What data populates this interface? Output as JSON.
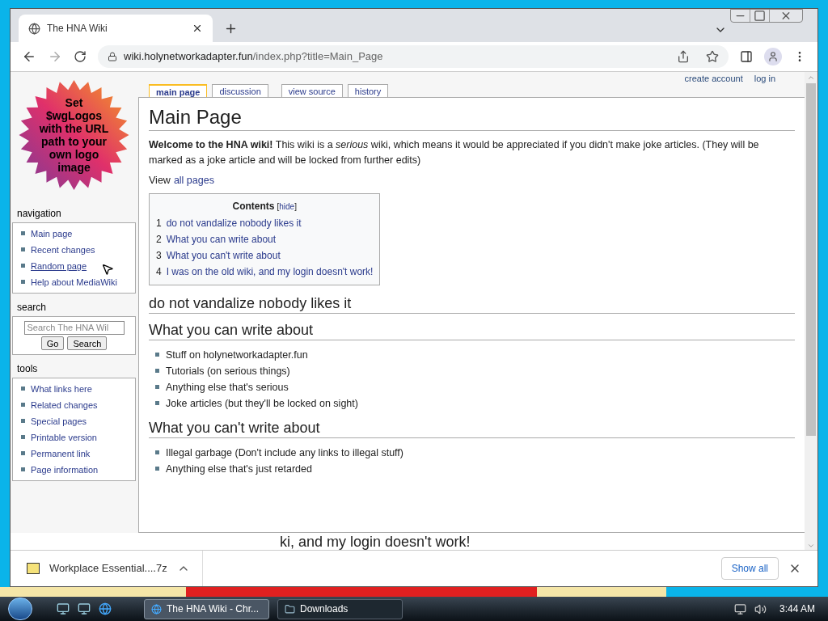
{
  "browser": {
    "tabs": [
      {
        "title": "The HNA Wiki",
        "selected": true
      }
    ],
    "url_host": "wiki.holynetworkadapter.fun",
    "url_path": "/index.php?title=Main_Page"
  },
  "wiki": {
    "personal_links": [
      "create account",
      "log in"
    ],
    "page_tabs": [
      {
        "label": "main page",
        "selected": true
      },
      {
        "label": "discussion",
        "selected": false
      },
      {
        "label": "view source",
        "selected": false
      },
      {
        "label": "history",
        "selected": false
      }
    ],
    "title": "Main Page",
    "intro": "**Welcome to the HNA wiki!** This wiki is a *serious* wiki, which means it would be appreciated if you didn't make joke articles. (They will be marked as a joke article and will be locked from further edits)",
    "view_all": {
      "prefix": "View",
      "link": "all pages"
    },
    "toc": {
      "title": "Contents",
      "toggle": {
        "open": "[",
        "label": "hide",
        "close": "]"
      },
      "items": [
        {
          "number": "1",
          "label": "do not vandalize nobody likes it"
        },
        {
          "number": "2",
          "label": "What you can write about"
        },
        {
          "number": "3",
          "label": "What you can't write about"
        },
        {
          "number": "4",
          "label": "I was on the old wiki, and my login doesn't work!"
        }
      ]
    },
    "sections": [
      {
        "heading": "do not vandalize nobody likes it"
      },
      {
        "heading": "What you can write about",
        "items": [
          "Stuff on holynetworkadapter.fun",
          "Tutorials (on serious things)",
          "Anything else that's serious",
          "Joke articles (but they'll be locked on sight)"
        ]
      },
      {
        "heading": "What you can't write about",
        "items": [
          "Illegal garbage (Don't include any links to illegal stuff)",
          "Anything else that's just retarded"
        ]
      }
    ],
    "cut_heading": "ki, and my login doesn't work!"
  },
  "sidebar": {
    "logo_text": "Set $wgLogos with the URL path to your own logo image",
    "navigation": {
      "title": "navigation",
      "items": [
        {
          "label": "Main page",
          "hovered": false
        },
        {
          "label": "Recent changes",
          "hovered": false
        },
        {
          "label": "Random page",
          "hovered": true
        },
        {
          "label": "Help about MediaWiki",
          "hovered": false
        }
      ]
    },
    "search": {
      "title": "search",
      "placeholder": "Search The HNA Wil",
      "buttons": [
        "Go",
        "Search"
      ]
    },
    "tools": {
      "title": "tools",
      "items": [
        {
          "label": "What links here",
          "hovered": false
        },
        {
          "label": "Related changes",
          "hovered": false
        },
        {
          "label": "Special pages",
          "hovered": false
        },
        {
          "label": "Printable version",
          "hovered": false
        },
        {
          "label": "Permanent link",
          "hovered": false
        },
        {
          "label": "Page information",
          "hovered": false
        }
      ]
    }
  },
  "downloads": {
    "file": "Workplace Essential....7z",
    "show_all": "Show all"
  },
  "taskbar": {
    "items": [
      {
        "label": "The HNA Wiki - Chr...",
        "selected": true
      },
      {
        "label": "Downloads",
        "selected": false
      }
    ],
    "time": "3:44 AM"
  }
}
